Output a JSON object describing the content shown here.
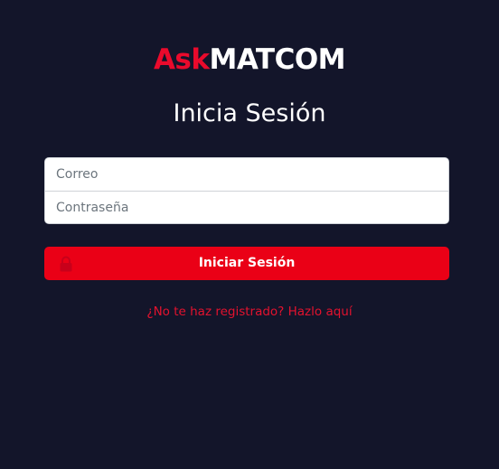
{
  "logo": {
    "part1": "Ask",
    "part2": "MATCOM"
  },
  "page_title": "Inicia Sesión",
  "form": {
    "email_placeholder": "Correo",
    "email_value": "",
    "password_placeholder": "Contraseña",
    "password_value": "",
    "submit_label": "Iniciar Sesión",
    "submit_icon": "lock-icon"
  },
  "register_link": "¿No te haz registrado? Hazlo aquí",
  "colors": {
    "background": "#13152a",
    "accent": "#ea0016",
    "link": "#e3122e",
    "text": "#ffffff"
  }
}
